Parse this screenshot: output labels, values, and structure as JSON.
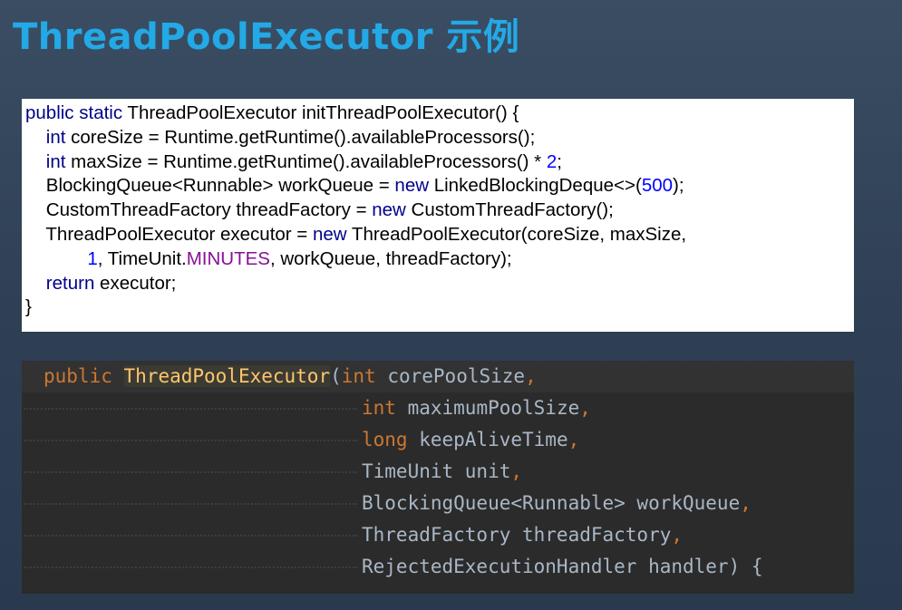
{
  "title": "ThreadPoolExecutor 示例",
  "snippet1": {
    "lines": [
      [
        {
          "t": "public static",
          "c": "kw"
        },
        {
          "t": " ThreadPoolExecutor initThreadPoolExecutor() {",
          "c": ""
        }
      ],
      [
        {
          "t": "    ",
          "c": ""
        },
        {
          "t": "int",
          "c": "kw"
        },
        {
          "t": " coreSize = Runtime.getRuntime().availableProcessors();",
          "c": ""
        }
      ],
      [
        {
          "t": "    ",
          "c": ""
        },
        {
          "t": "int",
          "c": "kw"
        },
        {
          "t": " maxSize = Runtime.getRuntime().availableProcessors() * ",
          "c": ""
        },
        {
          "t": "2",
          "c": "num"
        },
        {
          "t": ";",
          "c": ""
        }
      ],
      [
        {
          "t": "    BlockingQueue<Runnable> workQueue = ",
          "c": ""
        },
        {
          "t": "new",
          "c": "kw"
        },
        {
          "t": " LinkedBlockingDeque<>(",
          "c": ""
        },
        {
          "t": "500",
          "c": "num"
        },
        {
          "t": ");",
          "c": ""
        }
      ],
      [
        {
          "t": "    CustomThreadFactory threadFactory = ",
          "c": ""
        },
        {
          "t": "new",
          "c": "kw"
        },
        {
          "t": " CustomThreadFactory();",
          "c": ""
        }
      ],
      [
        {
          "t": "    ThreadPoolExecutor executor = ",
          "c": ""
        },
        {
          "t": "new",
          "c": "kw"
        },
        {
          "t": " ThreadPoolExecutor(coreSize, maxSize,",
          "c": ""
        }
      ],
      [
        {
          "t": "            ",
          "c": ""
        },
        {
          "t": "1",
          "c": "num"
        },
        {
          "t": ", TimeUnit.",
          "c": ""
        },
        {
          "t": "MINUTES",
          "c": "cst"
        },
        {
          "t": ", workQueue, threadFactory);",
          "c": ""
        }
      ],
      [
        {
          "t": "    ",
          "c": ""
        },
        {
          "t": "return",
          "c": "kw"
        },
        {
          "t": " executor;",
          "c": ""
        }
      ],
      [
        {
          "t": "}",
          "c": ""
        }
      ]
    ]
  },
  "snippet2": {
    "lines": [
      [
        {
          "t": "public",
          "c": "k2"
        },
        {
          "t": " ",
          "c": ""
        },
        {
          "t": "ThreadPoolExecutor",
          "c": "fn"
        },
        {
          "t": "(",
          "c": ""
        },
        {
          "t": "int",
          "c": "k2"
        },
        {
          "t": " corePoolSize",
          "c": ""
        },
        {
          "t": ",",
          "c": "k2"
        }
      ],
      [
        {
          "t": "int",
          "c": "k2"
        },
        {
          "t": " maximumPoolSize",
          "c": ""
        },
        {
          "t": ",",
          "c": "k2"
        }
      ],
      [
        {
          "t": "long",
          "c": "k2"
        },
        {
          "t": " keepAliveTime",
          "c": ""
        },
        {
          "t": ",",
          "c": "k2"
        }
      ],
      [
        {
          "t": "TimeUnit unit",
          "c": ""
        },
        {
          "t": ",",
          "c": "k2"
        }
      ],
      [
        {
          "t": "BlockingQueue<Runnable> workQueue",
          "c": ""
        },
        {
          "t": ",",
          "c": "k2"
        }
      ],
      [
        {
          "t": "ThreadFactory threadFactory",
          "c": ""
        },
        {
          "t": ",",
          "c": "k2"
        }
      ],
      [
        {
          "t": "RejectedExecutionHandler handler) {",
          "c": ""
        }
      ]
    ]
  }
}
